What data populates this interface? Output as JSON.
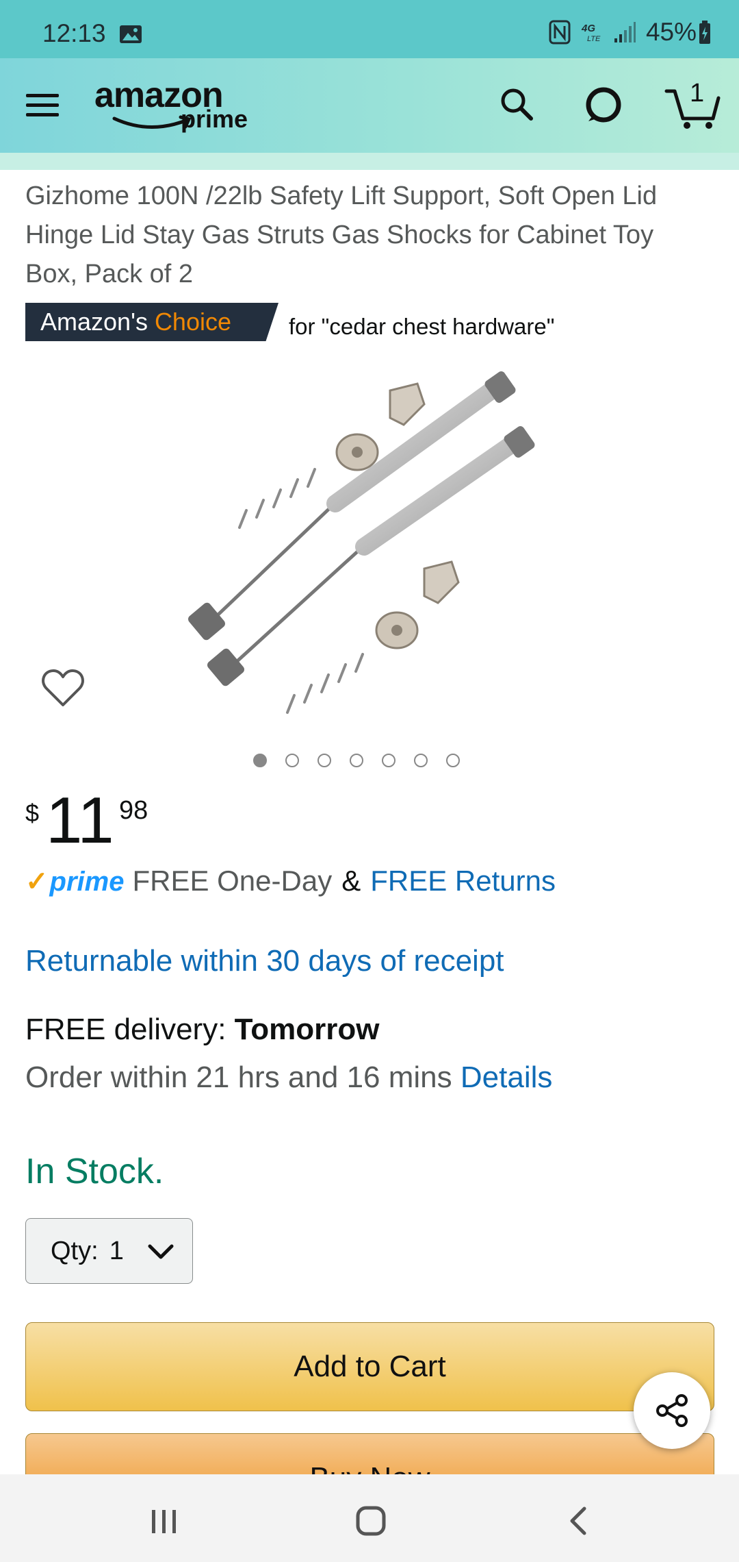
{
  "status_bar": {
    "time": "12:13",
    "network": "4G LTE",
    "battery": "45%"
  },
  "header": {
    "logo_text": "amazon",
    "logo_subtext": "prime",
    "cart_count": "1",
    "colors": {
      "start": "#7fd5da",
      "end": "#b7ecd8"
    }
  },
  "product": {
    "title": "Gizhome 100N /22lb Safety Lift Support, Soft Open Lid Hinge Lid Stay Gas Struts Gas Shocks for Cabinet Toy Box, Pack of 2",
    "badge": {
      "prefix": "Amazon's",
      "accent": "Choice",
      "query_text": "for \"cedar chest hardware\""
    },
    "image_count": 7,
    "active_image_index": 0
  },
  "price": {
    "symbol": "$",
    "whole": "11",
    "fraction": "98"
  },
  "shipping": {
    "prime_label": "prime",
    "one_day": "FREE One-Day",
    "amp": "&",
    "free_returns": "FREE Returns",
    "returnable": "Returnable within 30 days of receipt",
    "delivery_prefix": "FREE delivery:",
    "delivery_day": "Tomorrow",
    "order_within": "Order within 21 hrs and 16 mins",
    "details_link": "Details"
  },
  "stock": {
    "status": "In Stock."
  },
  "quantity": {
    "label": "Qty:",
    "value": "1"
  },
  "actions": {
    "add_to_cart": "Add to Cart",
    "buy_now": "Buy Now"
  },
  "icons": {
    "menu": "hamburger-icon",
    "search": "search-icon",
    "alexa": "alexa-icon",
    "cart": "cart-icon",
    "wishlist": "heart-icon",
    "share": "share-icon"
  }
}
